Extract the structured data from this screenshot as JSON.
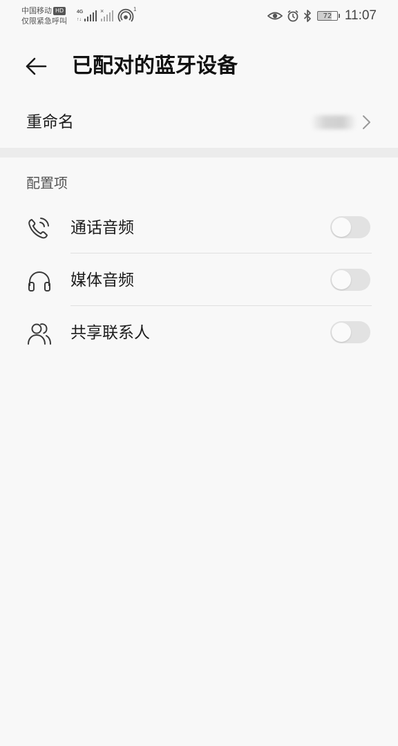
{
  "status_bar": {
    "carrier_line1": "中国移动",
    "hd_badge": "HD",
    "carrier_line2": "仅限紧急呼叫",
    "network_type": "4G",
    "battery_level": "72",
    "time": "11:07"
  },
  "header": {
    "title": "已配对的蓝牙设备"
  },
  "rename": {
    "label": "重命名",
    "value": "▒▒▒▒"
  },
  "config": {
    "section_title": "配置项",
    "items": [
      {
        "label": "通话音频",
        "icon": "phone-call-icon",
        "enabled": false
      },
      {
        "label": "媒体音频",
        "icon": "headphones-icon",
        "enabled": false
      },
      {
        "label": "共享联系人",
        "icon": "contacts-icon",
        "enabled": false
      }
    ]
  },
  "colors": {
    "background": "#f8f8f8",
    "toggle_off": "#e2e2e2",
    "section_gap": "#ececec"
  }
}
